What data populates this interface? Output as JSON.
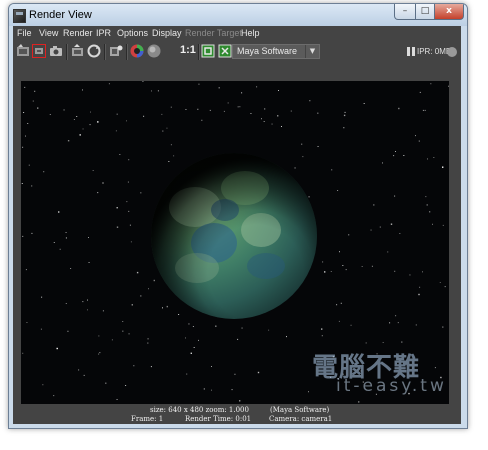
{
  "window": {
    "title": "Render View",
    "caption_buttons": {
      "minimize": "–",
      "maximize": "□",
      "close": "x"
    }
  },
  "menu": {
    "items": [
      {
        "label": "File",
        "enabled": true
      },
      {
        "label": "View",
        "enabled": true
      },
      {
        "label": "Render",
        "enabled": true
      },
      {
        "label": "IPR",
        "enabled": true
      },
      {
        "label": "Options",
        "enabled": true
      },
      {
        "label": "Display",
        "enabled": true
      },
      {
        "label": "Render Target",
        "enabled": false
      },
      {
        "label": "Help",
        "enabled": true
      }
    ]
  },
  "toolbar": {
    "icons": [
      "redo-render-icon",
      "render-region-icon",
      "snapshot-icon",
      "ipr-render-icon",
      "refresh-ipr-icon",
      "render-settings-icon",
      "rgb-channels-icon",
      "alpha-channel-icon",
      "keep-image-icon",
      "remove-image-icon"
    ],
    "ratio_label": "1:1",
    "renderer": {
      "selected": "Maya Software"
    },
    "ipr_memory": "IPR: 0MB"
  },
  "render": {
    "caption_line1": "size: 640 x 480 zoom: 1.000",
    "caption_line1_right": "(Maya Software)",
    "caption_frame": "Frame: 1",
    "caption_time": "Render Time: 0:01",
    "caption_camera": "Camera: camera1"
  },
  "watermark": {
    "chinese": "電腦不難",
    "latin": "it-easy.tw"
  },
  "colors": {
    "panel_bg": "#444444",
    "viewport_bg": "#050608",
    "titlebar": "#cbdbeb",
    "planet_green": "#5b9a6e",
    "planet_blue": "#2f5f86",
    "close_button": "#c4402b"
  }
}
